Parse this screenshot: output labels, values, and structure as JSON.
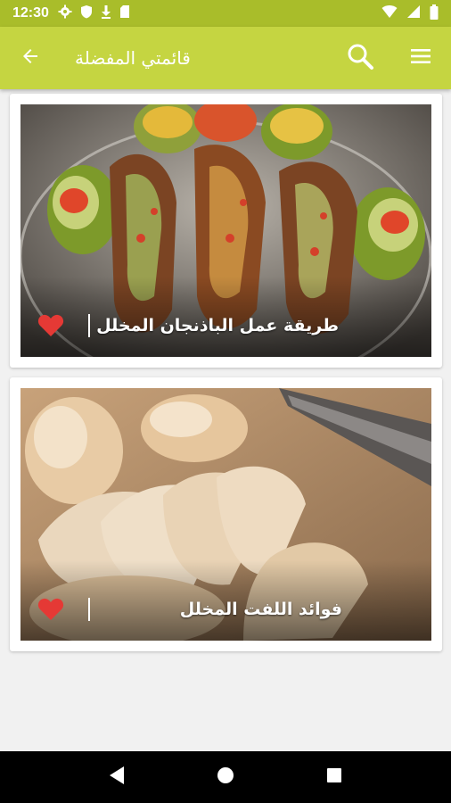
{
  "status_bar": {
    "time": "12:30",
    "left_icons": [
      "gear-icon",
      "shield-icon",
      "download-icon",
      "sd-card-icon"
    ],
    "right_icons": [
      "wifi-icon",
      "signal-icon",
      "battery-icon"
    ]
  },
  "app_bar": {
    "title": "قائمتي المفضلة",
    "back_icon": "arrow-back-icon",
    "search_icon": "search-icon",
    "menu_icon": "menu-icon",
    "color": "#c5d541"
  },
  "recipes": [
    {
      "name": "طريقة عمل الباذنجان المخلل",
      "favorite": true,
      "photo": "stuffed-eggplant-photo"
    },
    {
      "name": "فوائد اللفت المخلل",
      "favorite": true,
      "photo": "pickled-turnip-photo"
    }
  ],
  "colors": {
    "status_bar": "#a9bd2a",
    "heart": "#e53935"
  },
  "nav_bar": {
    "buttons": [
      "back-triangle-icon",
      "home-circle-icon",
      "recents-square-icon"
    ]
  }
}
